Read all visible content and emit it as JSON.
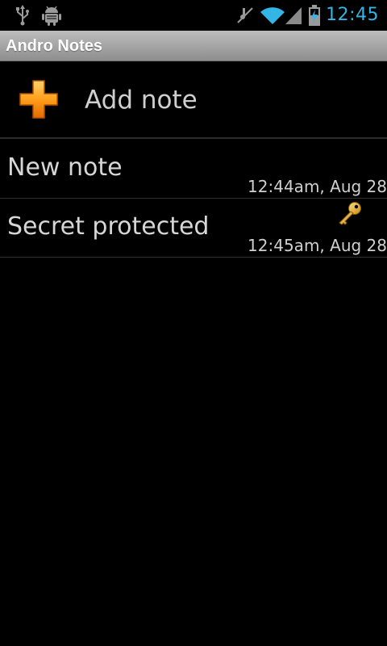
{
  "status_bar": {
    "time": "12:45",
    "icons": [
      "usb-icon",
      "android-debug-icon",
      "mute-icon",
      "wifi-icon",
      "signal-icon",
      "battery-charging-icon"
    ],
    "clock_color": "#33b5e5"
  },
  "app": {
    "title": "Andro Notes"
  },
  "add_note": {
    "label": "Add note",
    "icon": "plus-icon",
    "icon_color": "#ff9800"
  },
  "notes": [
    {
      "title": "New note",
      "date": "12:44am, Aug 28",
      "locked": false
    },
    {
      "title": "Secret protected",
      "date": "12:45am, Aug 28",
      "locked": true,
      "lock_icon": "key-icon"
    }
  ]
}
